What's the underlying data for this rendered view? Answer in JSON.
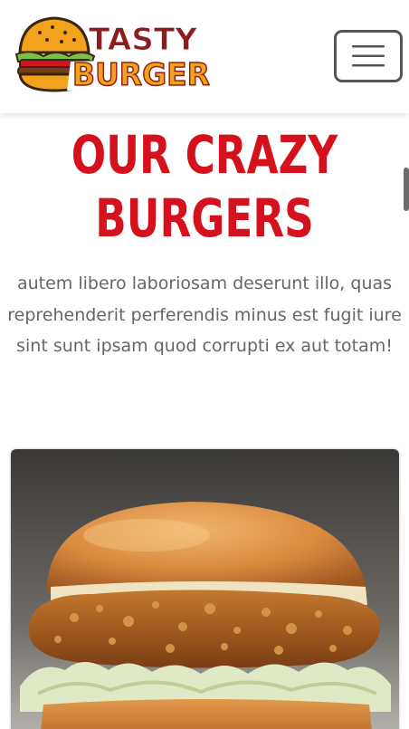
{
  "header": {
    "logo": {
      "line1": "TASTY",
      "line2": "BURGER",
      "icon": "burger-logo-icon"
    },
    "menu_icon": "hamburger-menu-icon"
  },
  "section": {
    "title_line1": "OUR CRAZY",
    "title_line2": "BURGERS",
    "description": "autem libero laboriosam deserunt illo, quas reprehenderit perferendis minus est fugit iure sint sunt ipsam quod corrupti ex aut totam!"
  },
  "colors": {
    "accent_red": "#d6111e",
    "logo_dark_red": "#8e1c1c",
    "logo_orange": "#f2a31b",
    "text_gray": "#666666"
  },
  "card": {
    "image": "fried-chicken-burger-photo"
  }
}
